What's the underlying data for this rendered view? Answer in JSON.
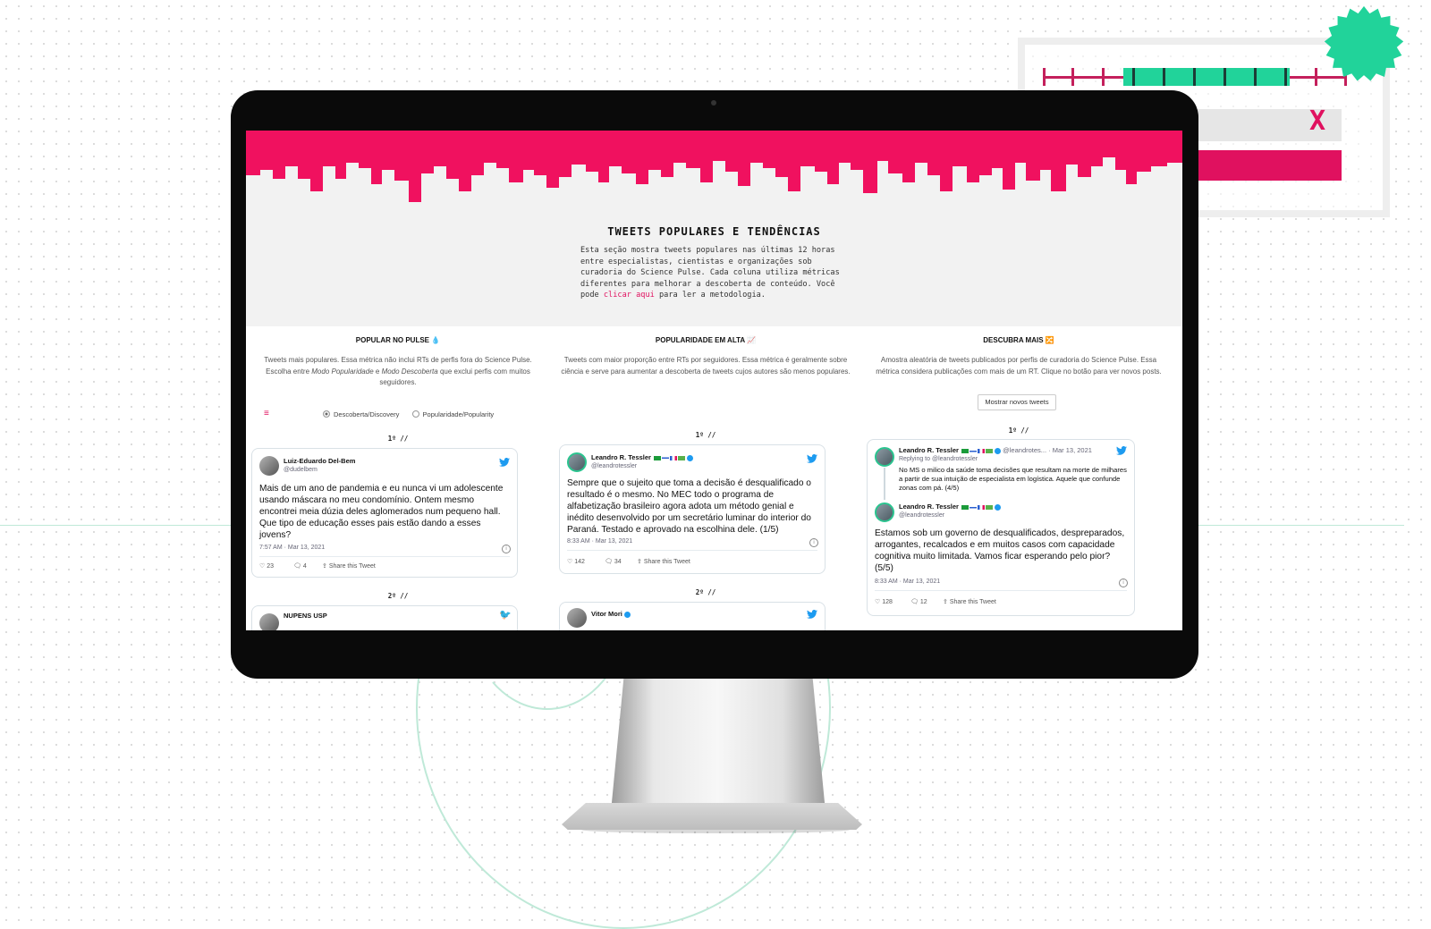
{
  "page": {
    "title": "TWEETS POPULARES E TENDÊNCIAS",
    "desc_pre": "Esta seção mostra tweets populares nas últimas 12 horas entre especialistas, cientistas e organizações sob curadoria do Science Pulse. Cada coluna utiliza métricas diferentes para melhorar a descoberta de conteúdo. Você pode ",
    "desc_link": "clicar aqui",
    "desc_post": " para ler a metodologia."
  },
  "colors": {
    "accent": "#e0115f",
    "green": "#21d39a",
    "twitter": "#1d9bf0"
  },
  "columns": [
    {
      "title": "POPULAR NO PULSE 💧",
      "desc_a": "Tweets mais populares. Essa métrica não inclui RTs de perfis fora do Science Pulse. Escolha entre ",
      "desc_i1": "Modo Popularidade",
      "desc_b": " e ",
      "desc_i2": "Modo Descoberta",
      "desc_c": " que exclui perfis com muitos seguidores.",
      "menu_icon": "≡",
      "radio_discovery": "Descoberta/Discovery",
      "radio_popularity": "Popularidade/Popularity",
      "rank1": "1º //",
      "rank2": "2º //",
      "tweet1": {
        "name": "Luiz-Eduardo Del-Bem",
        "handle": "@dudelbem",
        "text": "Mais de um ano de pandemia e eu nunca vi um adolescente usando máscara no meu condomínio. Ontem mesmo encontrei meia dúzia deles aglomerados num pequeno hall. Que tipo de educação esses pais estão dando a esses jovens?",
        "time": "7:57 AM · Mar 13, 2021",
        "likes": "23",
        "replies": "4",
        "share": "Share this Tweet"
      },
      "tweet2_name": "NUPENS USP"
    },
    {
      "title": "POPULARIDADE EM ALTA 📈",
      "desc": "Tweets com maior proporção entre RTs por seguidores. Essa métrica é geralmente sobre ciência e serve para aumentar a descoberta de tweets cujos autores são menos populares.",
      "rank1": "1º //",
      "rank2": "2º //",
      "tweet1": {
        "name": "Leandro R. Tessler",
        "handle": "@leandrotessler",
        "text": "Sempre que o sujeito que toma a decisão é desqualificado o resultado é o mesmo. No MEC todo o programa de alfabetização brasileiro agora adota um método genial e inédito desenvolvido por um secretário luminar do interior do Paraná. Testado e aprovado na escolhina dele. (1/5)",
        "time": "8:33 AM · Mar 13, 2021",
        "likes": "142",
        "replies": "34",
        "share": "Share this Tweet"
      },
      "tweet2_name": "Vitor Mori"
    },
    {
      "title": "DESCUBRA MAIS 🔀",
      "desc": "Amostra aleatória de tweets publicados por perfis de curadoria do Science Pulse. Essa métrica considera publicações com mais de um RT. Clique no botão para ver novos posts.",
      "more_button": "Mostrar novos tweets",
      "rank1": "1º //",
      "tweet1": {
        "reply_name": "Leandro R. Tessler",
        "reply_handle": "@leandrotes...",
        "reply_time": "· Mar 13, 2021",
        "replying_to": "Replying to @leandrotessler",
        "reply_text": "No MS o milico da saúde toma decisões que resultam na morte de milhares a partir de sua intuição de especialista em logística. Aquele que confunde zonas com pá. (4/5)",
        "name": "Leandro R. Tessler",
        "handle": "@leandrotessler",
        "text": "Estamos sob um governo de desqualificados, despreparados, arrogantes, recalcados e em muitos casos com capacidade cognitiva muito limitada. Vamos ficar esperando pelo pior? (5/5)",
        "time": "8:33 AM · Mar 13, 2021",
        "likes": "128",
        "replies": "12",
        "share": "Share this Tweet"
      }
    }
  ],
  "decor": {
    "close_mark": "X"
  }
}
